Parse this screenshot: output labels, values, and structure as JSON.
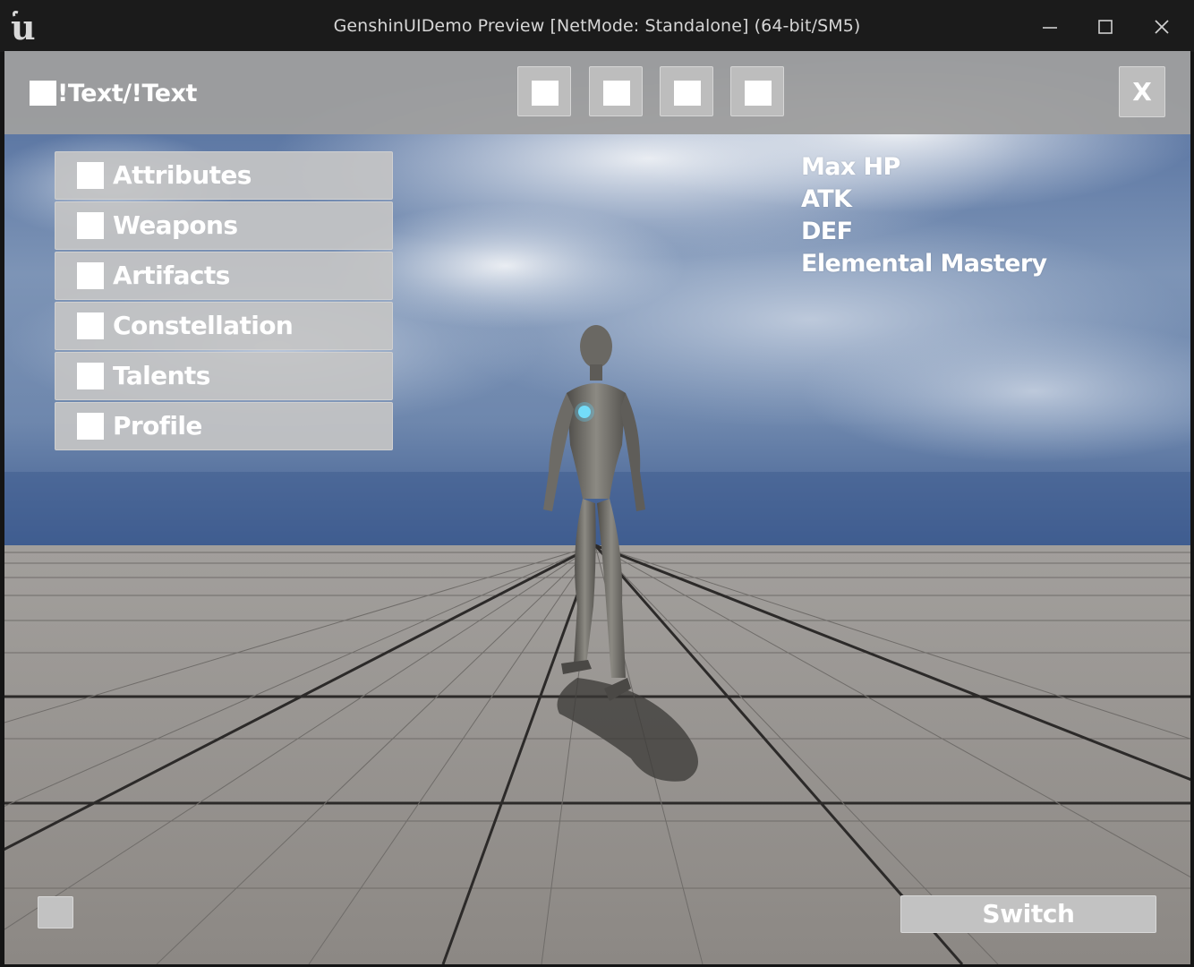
{
  "window": {
    "title": "GenshinUIDemo Preview [NetMode: Standalone]  (64-bit/SM5)",
    "logo_icon": "unreal-engine-logo",
    "controls": [
      "minimize-icon",
      "maximize-icon",
      "close-icon"
    ]
  },
  "header": {
    "title": "!Text/!Text",
    "tabs": [
      "tab-square",
      "tab-square",
      "tab-square",
      "tab-square"
    ],
    "close_label": "X"
  },
  "menu": {
    "items": [
      {
        "label": "Attributes"
      },
      {
        "label": "Weapons"
      },
      {
        "label": "Artifacts"
      },
      {
        "label": "Constellation"
      },
      {
        "label": "Talents"
      },
      {
        "label": "Profile"
      }
    ]
  },
  "stats": {
    "items": [
      "Max HP",
      "ATK",
      "DEF",
      "Elemental Mastery"
    ]
  },
  "footer": {
    "switch_label": "Switch"
  },
  "colors": {
    "panel": "#bdbdbd",
    "topbar": "#9e9e9e",
    "text": "#ffffff",
    "titlebar": "#1b1b1b",
    "sky_top": "#4e6c9e",
    "floor": "#8e8a86"
  }
}
